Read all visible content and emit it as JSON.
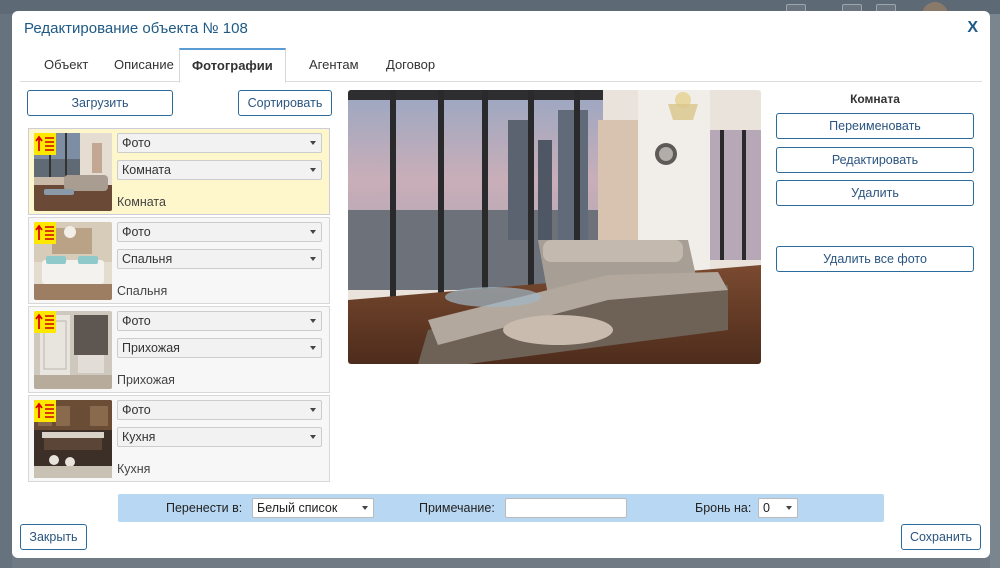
{
  "modal": {
    "title": "Редактирование объекта № 108",
    "close_label": "X"
  },
  "tabs": [
    {
      "label": "Объект"
    },
    {
      "label": "Описание"
    },
    {
      "label": "Фотографии",
      "active": true
    },
    {
      "label": "Агентам"
    },
    {
      "label": "Договор"
    }
  ],
  "toolbar": {
    "upload_label": "Загрузить",
    "sort_label": "Сортировать"
  },
  "photos": [
    {
      "type": "Фото",
      "room": "Комната",
      "caption": "Комната",
      "thumb_icon": "living-room-thumbnail"
    },
    {
      "type": "Фото",
      "room": "Спальня",
      "caption": "Спальня",
      "thumb_icon": "bedroom-thumbnail"
    },
    {
      "type": "Фото",
      "room": "Прихожая",
      "caption": "Прихожая",
      "thumb_icon": "hallway-thumbnail"
    },
    {
      "type": "Фото",
      "room": "Кухня",
      "caption": "Кухня",
      "thumb_icon": "kitchen-thumbnail"
    }
  ],
  "preview": {
    "icon": "living-room-photo"
  },
  "actions": {
    "title": "Комната",
    "rename_label": "Переименовать",
    "edit_label": "Редактировать",
    "delete_label": "Удалить",
    "delete_all_label": "Удалить все фото"
  },
  "bottom_bar": {
    "move_label": "Перенести в:",
    "move_value": "Белый список",
    "note_label": "Примечание:",
    "note_value": "",
    "reserve_label": "Бронь на:",
    "reserve_value": "0"
  },
  "footer": {
    "close_label": "Закрыть",
    "save_label": "Сохранить"
  },
  "colors": {
    "accent": "#1e5a85",
    "selected_row": "#fff7cc",
    "bottom_bar": "#b8d7f2",
    "sort_badge": "#ffe800"
  }
}
